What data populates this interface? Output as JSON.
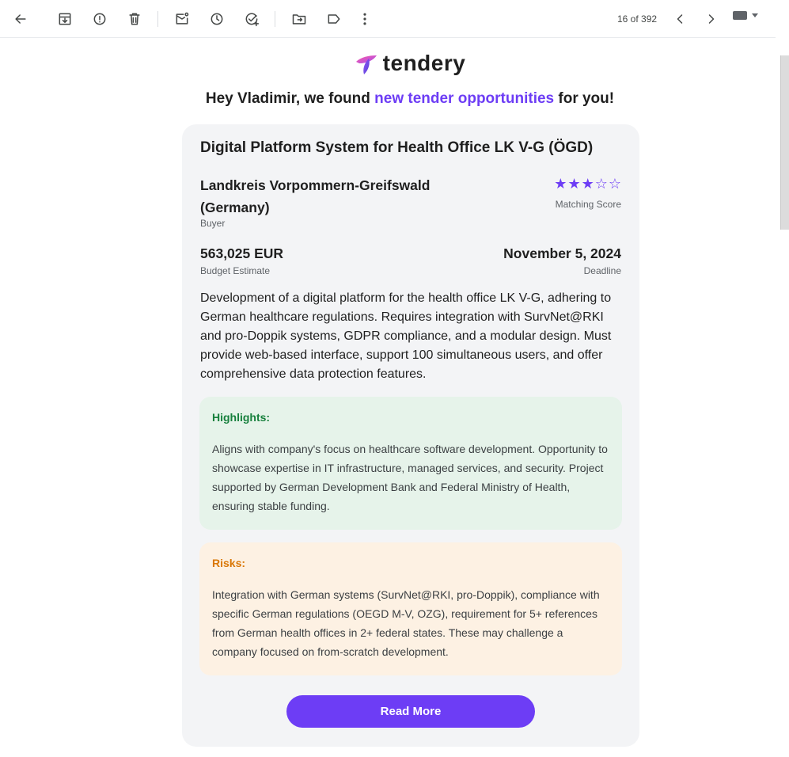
{
  "toolbar": {
    "page_count": "16 of 392",
    "icons": [
      "back-arrow-icon",
      "archive-icon",
      "report-spam-icon",
      "delete-icon",
      "mark-unread-icon",
      "snooze-icon",
      "add-task-icon",
      "move-to-icon",
      "label-icon",
      "more-icon",
      "prev-icon",
      "next-icon",
      "keyboard-icon"
    ]
  },
  "logo": {
    "text": "tendery"
  },
  "greeting": {
    "prefix": "Hey Vladimir, we found ",
    "accent": "new tender opportunities",
    "suffix": " for you!"
  },
  "tender": {
    "title": "Digital Platform System for Health Office LK V-G (ÖGD)",
    "buyer": "Landkreis Vorpommern-Greifswald (Germany)",
    "buyer_label": "Buyer",
    "matching_score": 3,
    "matching_score_max": 5,
    "matching_label": "Matching Score",
    "budget": "563,025 EUR",
    "budget_label": "Budget Estimate",
    "deadline": "November 5, 2024",
    "deadline_label": "Deadline",
    "description": "Development of a digital platform for the health office LK V-G, adhering to German healthcare regulations. Requires integration with SurvNet@RKI and pro-Doppik systems, GDPR compliance, and a modular design. Must provide web-based interface, support 100 simultaneous users, and offer comprehensive data protection features.",
    "highlights_title": "Highlights:",
    "highlights_text": "Aligns with company's focus on healthcare software development. Opportunity to showcase expertise in IT infrastructure, managed services, and security. Project supported by German Development Bank and Federal Ministry of Health, ensuring stable funding.",
    "risks_title": "Risks:",
    "risks_text": "Integration with German systems (SurvNet@RKI, pro-Doppik), compliance with specific German regulations (OEGD M-V, OZG), requirement for 5+ references from German health offices in 2+ federal states. These may challenge a company focused on from-scratch development.",
    "cta": "Read More"
  },
  "colors": {
    "accent": "#6d3df5",
    "highlight_green": "#17803d",
    "risk_orange": "#d97706"
  }
}
